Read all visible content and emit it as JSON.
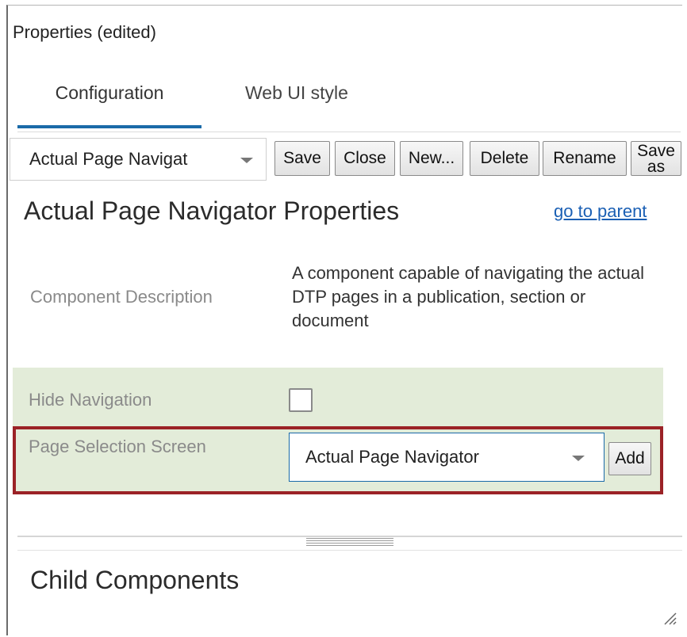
{
  "panel": {
    "title": "Properties (edited)"
  },
  "tabs": [
    {
      "label": "Configuration",
      "active": true
    },
    {
      "label": "Web UI style",
      "active": false
    }
  ],
  "toolbar": {
    "component_select": "Actual Page Navigat",
    "buttons": {
      "save": "Save",
      "close": "Close",
      "new": "New...",
      "delete": "Delete",
      "rename": "Rename",
      "save_as": "Save as"
    }
  },
  "properties": {
    "title": "Actual Page Navigator Properties",
    "go_to_parent": "go to parent",
    "component_description_label": "Component Description",
    "component_description_value": "A component capable of navigating the actual DTP pages in a publication, section or document",
    "hide_navigation_label": "Hide Navigation",
    "hide_navigation_checked": false,
    "page_selection_screen_label": "Page Selection Screen",
    "page_selection_screen_value": "Actual Page Navigator",
    "add_button": "Add"
  },
  "child_components": {
    "title": "Child Components"
  },
  "colors": {
    "accent": "#1a6aa8",
    "highlight_border": "#9b2226",
    "section_background": "#e3ecd9",
    "link": "#1a5fb4"
  }
}
